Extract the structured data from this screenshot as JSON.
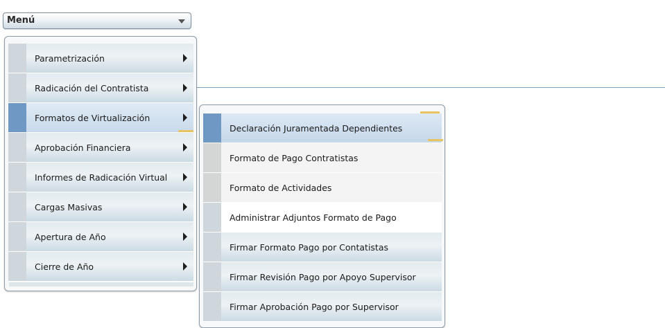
{
  "menu_button": {
    "label": "Menú"
  },
  "main_menu": {
    "items": [
      {
        "label": "Parametrización"
      },
      {
        "label": "Radicación del Contratista"
      },
      {
        "label": "Formatos de Virtualización"
      },
      {
        "label": "Aprobación Financiera"
      },
      {
        "label": "Informes de Radicación Virtual"
      },
      {
        "label": "Cargas Masivas"
      },
      {
        "label": "Apertura de Año"
      },
      {
        "label": "Cierre de Año"
      }
    ]
  },
  "submenu": {
    "items": [
      {
        "label": "Declaración Juramentada Dependientes"
      },
      {
        "label": "Formato de Pago Contratistas"
      },
      {
        "label": "Formato de Actividades"
      },
      {
        "label": "Administrar Adjuntos Formato de Pago"
      },
      {
        "label": "Firmar Formato Pago por Contatistas"
      },
      {
        "label": "Firmar Revisión Pago por Apoyo Supervisor"
      },
      {
        "label": "Firmar Aprobación Pago por Supervisor"
      }
    ]
  },
  "colors": {
    "accent": "#e8c460",
    "active_stripe": "#6f98c4",
    "connector": "#7aa1be"
  }
}
